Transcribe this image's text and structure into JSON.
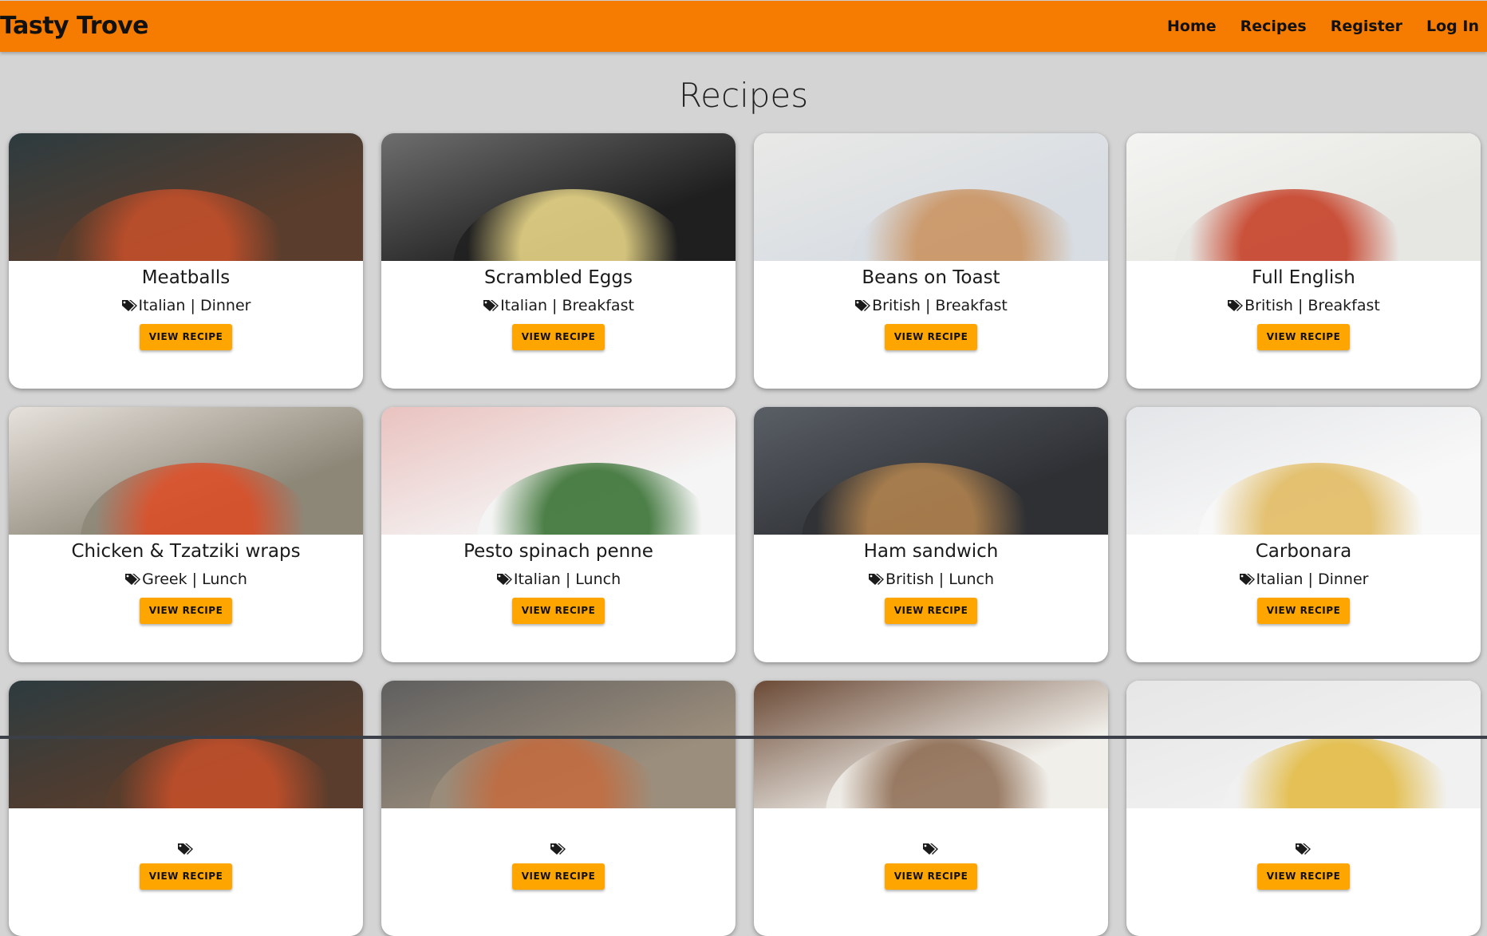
{
  "header": {
    "brand": "Tasty Trove",
    "nav": [
      "Home",
      "Recipes",
      "Register",
      "Log In"
    ]
  },
  "page": {
    "title": "Recipes"
  },
  "button_label": "VIEW RECIPE",
  "recipes": [
    {
      "title": "Meatballs",
      "cuisine": "Italian",
      "meal": "Dinner",
      "meta": "Italian | Dinner",
      "image": "meatballs-pan",
      "colors": [
        "#2d3b3f",
        "#5a3d2c",
        "#c8502a"
      ]
    },
    {
      "title": "Scrambled Eggs",
      "cuisine": "Italian",
      "meal": "Breakfast",
      "meta": "Italian | Breakfast",
      "image": "scrambled-eggs-pan",
      "colors": [
        "#6e6e6e",
        "#1f1f1f",
        "#f2df8c"
      ]
    },
    {
      "title": "Beans on Toast",
      "cuisine": "British",
      "meal": "Breakfast",
      "meta": "British | Breakfast",
      "image": "beans-on-toast-plate",
      "colors": [
        "#e9e9e6",
        "#d8dde3",
        "#c98f5a"
      ]
    },
    {
      "title": "Full English",
      "cuisine": "British",
      "meal": "Breakfast",
      "meta": "British | Breakfast",
      "image": "full-english-plate",
      "colors": [
        "#f4f4f2",
        "#e6e6e2",
        "#c4361c"
      ]
    },
    {
      "title": "Chicken & Tzatziki wraps",
      "cuisine": "Greek",
      "meal": "Lunch",
      "meta": "Greek | Lunch",
      "image": "tzatziki-bowls",
      "colors": [
        "#e7e2dc",
        "#8d8778",
        "#e04a22"
      ]
    },
    {
      "title": "Pesto spinach penne",
      "cuisine": "Italian",
      "meal": "Lunch",
      "meta": "Italian | Lunch",
      "image": "pesto-penne-bowl",
      "colors": [
        "#e9c2bf",
        "#f5f5f5",
        "#2f6b2a"
      ]
    },
    {
      "title": "Ham sandwich",
      "cuisine": "British",
      "meal": "Lunch",
      "meta": "British | Lunch",
      "image": "ham-sandwich",
      "colors": [
        "#5a5f66",
        "#2e3034",
        "#b8874f"
      ]
    },
    {
      "title": "Carbonara",
      "cuisine": "Italian",
      "meal": "Dinner",
      "meta": "Italian | Dinner",
      "image": "carbonara-plate",
      "colors": [
        "#e3e5e8",
        "#f8f8f8",
        "#e0b85a"
      ]
    },
    {
      "title": "",
      "meta": "",
      "image": "meatballs-pan",
      "colors": [
        "#2d3b3f",
        "#5a3d2c",
        "#c8502a"
      ]
    },
    {
      "title": "",
      "meta": "",
      "image": "pasta-bowl",
      "colors": [
        "#5f5f5f",
        "#9c8e7c",
        "#c56a3c"
      ]
    },
    {
      "title": "",
      "meta": "",
      "image": "soup-plate-wood",
      "colors": [
        "#6b4a36",
        "#f1efea",
        "#8c6a50"
      ]
    },
    {
      "title": "",
      "meta": "",
      "image": "omelette-frittata",
      "colors": [
        "#e6e6e6",
        "#f1f1f1",
        "#e2b83a"
      ]
    }
  ]
}
